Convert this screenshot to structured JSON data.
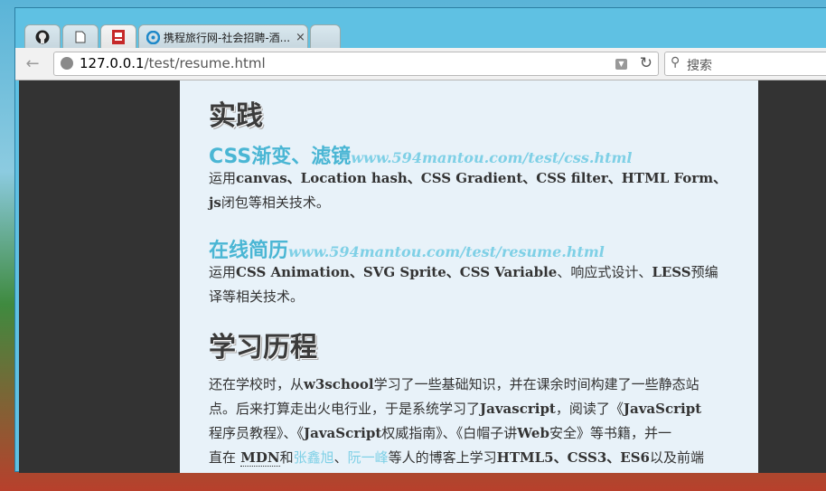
{
  "tabs": [
    {
      "kind": "github",
      "icon": "github-icon",
      "title": ""
    },
    {
      "kind": "file",
      "icon": "page-icon",
      "title": ""
    },
    {
      "kind": "resume",
      "icon": "resume-favicon-icon",
      "title": ""
    },
    {
      "kind": "ctrip",
      "icon": "ctrip-icon",
      "title": "携程旅行网-社会招聘-酒...",
      "close": "×"
    },
    {
      "kind": "new",
      "icon": "",
      "title": ""
    }
  ],
  "toolbar": {
    "url_host": "127.0.0.1",
    "url_path": "/test/resume.html",
    "search_placeholder": "搜索"
  },
  "page": {
    "section1_title": "实践",
    "project1": {
      "title": "CSS渐变、滤镜",
      "link": "www.594mantou.com/test/css.html",
      "desc_1": "运用",
      "desc_b1": "canvas、Location hash、CSS Gradient、CSS filter、HTML Form、",
      "desc_2a": "js",
      "desc_2": "闭包等相关技术。"
    },
    "project2": {
      "title": "在线简历",
      "link": "www.594mantou.com/test/resume.html",
      "desc_1": "运用",
      "desc_b1": "CSS Animation、SVG Sprite、CSS Variable",
      "desc_2": "、响应式设计、",
      "desc_b2": "LESS",
      "desc_3": "预编译等相关技术。"
    },
    "section2_title": "学习历程",
    "history": {
      "l1a": "还在学校时，从",
      "l1b": "w3school",
      "l1c": "学习了一些基础知识，并在课余时间构建了一些静态站",
      "l2a": "点。后来打算走出火电行业，于是系统学习了",
      "l2b": "Javascript",
      "l2c": "，阅读了《",
      "l2d": "JavaScript",
      "l3a": "程序员教程》、《",
      "l3b": "JavaScript",
      "l3c": "权威指南》、《白帽子讲",
      "l3d": "Web",
      "l3e": "安全》等书籍，并一",
      "l4a": "直在",
      "l4b": "MDN",
      "l4c": "和",
      "l4d": "张鑫旭",
      "l4e": "、",
      "l4f": "阮一峰",
      "l4g": "等人的博客上学习",
      "l4h": "HTML5、CSS3、ES6",
      "l4i": "以及前端"
    }
  }
}
